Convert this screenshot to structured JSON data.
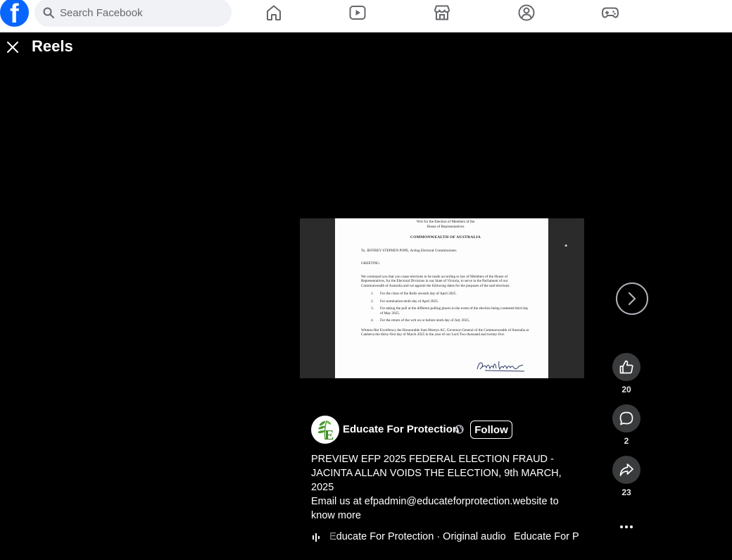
{
  "topbar": {
    "logo_letter": "f",
    "search_placeholder": "Search Facebook",
    "nav_icons": [
      "home-icon",
      "video-icon",
      "marketplace-icon",
      "groups-icon",
      "gaming-icon"
    ]
  },
  "reels": {
    "title": "Reels"
  },
  "video": {
    "doc_lines": {
      "title1": "Writ for the Election of Members of the",
      "title2": "House of Representatives",
      "heading": "COMMONWEALTH OF AUSTRALIA",
      "to": "To, JEFFREY STEPHEN POPE, Acting Electoral Commissioner.",
      "greeting": "GREETING.",
      "command": "We command you that you cause elections to be made according to law of Members of the House of Representatives, for the Electoral Divisions in our State of Victoria, to serve in the Parliament of our Commonwealth of Australia and we appoint the following dates for the purposes of the said elections:",
      "items": [
        {
          "n": "1.",
          "text": "For the close of the Rolls seventh day of April 2025."
        },
        {
          "n": "2.",
          "text": "For nomination tenth day of April 2025."
        },
        {
          "n": "3.",
          "text": "For taking the poll at the different polling places in the event of the election being contested third day of May 2025."
        },
        {
          "n": "4.",
          "text": "For the return of the writ on or before ninth day of July 2025."
        }
      ],
      "witness": "Witness Her Excellency the Honourable Sam Mostyn AC, Governor-General of the Commonwealth of Australia at Canberra the thirty-first day of March 2025 in the year of our Lord Two thousand and twenty-five."
    }
  },
  "actions": {
    "like_count": "20",
    "comment_count": "2",
    "share_count": "23"
  },
  "post": {
    "author": "Educate For Protection",
    "follow_label": "Follow",
    "caption": "PREVIEW EFP 2025 FEDERAL ELECTION FRAUD - JACINTA ALLAN VOIDS THE ELECTION, 9th MARCH, 2025",
    "email_line": "Email us at efpadmin@educateforprotection.website to know more",
    "audio_text": "Educate For Protection · Original audio",
    "audio_text_repeat": "Educate For Protection · Original audio"
  },
  "colors": {
    "brand": "#0866ff",
    "background": "#000000",
    "action_bg": "#3a3b3c",
    "avatar_leaf": "#4a9a2e"
  }
}
